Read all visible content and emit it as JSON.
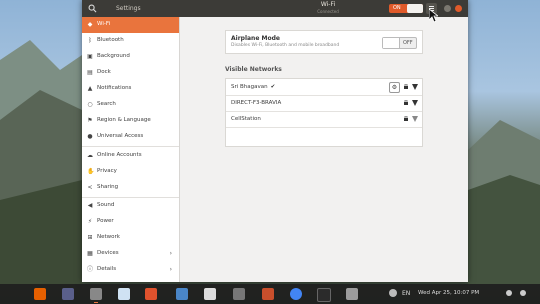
{
  "window": {
    "app_title": "Settings",
    "panel_title": "Wi-Fi",
    "panel_subtitle": "Connected",
    "wifi_toggle_label": "ON"
  },
  "sidebar": {
    "items": [
      {
        "label": "Wi-Fi",
        "icon": "wifi-icon",
        "active": true
      },
      {
        "label": "Bluetooth",
        "icon": "bluetooth-icon"
      },
      {
        "label": "Background",
        "icon": "background-icon"
      },
      {
        "label": "Dock",
        "icon": "dock-icon"
      },
      {
        "label": "Notifications",
        "icon": "bell-icon"
      },
      {
        "label": "Search",
        "icon": "search-icon"
      },
      {
        "label": "Region & Language",
        "icon": "flag-icon"
      },
      {
        "label": "Universal Access",
        "icon": "accessibility-icon"
      },
      {
        "label": "Online Accounts",
        "icon": "cloud-icon"
      },
      {
        "label": "Privacy",
        "icon": "hand-icon"
      },
      {
        "label": "Sharing",
        "icon": "share-icon"
      },
      {
        "label": "Sound",
        "icon": "speaker-icon"
      },
      {
        "label": "Power",
        "icon": "power-icon"
      },
      {
        "label": "Network",
        "icon": "network-icon"
      },
      {
        "label": "Devices",
        "icon": "printer-icon",
        "chevron": true
      },
      {
        "label": "Details",
        "icon": "info-icon",
        "chevron": true
      }
    ]
  },
  "airplane": {
    "title": "Airplane Mode",
    "description": "Disables Wi-Fi, Bluetooth and mobile broadband",
    "switch_label": "OFF"
  },
  "networks": {
    "section_title": "Visible Networks",
    "items": [
      {
        "name": "Sri Bhagavan",
        "connected": true,
        "checkmark": "✔"
      },
      {
        "name": "DIRECT-F3-BRAVIA",
        "connected": false
      },
      {
        "name": "CellStation",
        "connected": false
      }
    ]
  },
  "tray": {
    "clock": "Wed Apr 25, 10:07 PM",
    "language": "EN"
  },
  "colors": {
    "accent": "#e9743d",
    "headerbar": "#3c3b37",
    "window_bg": "#f2f1f0"
  }
}
